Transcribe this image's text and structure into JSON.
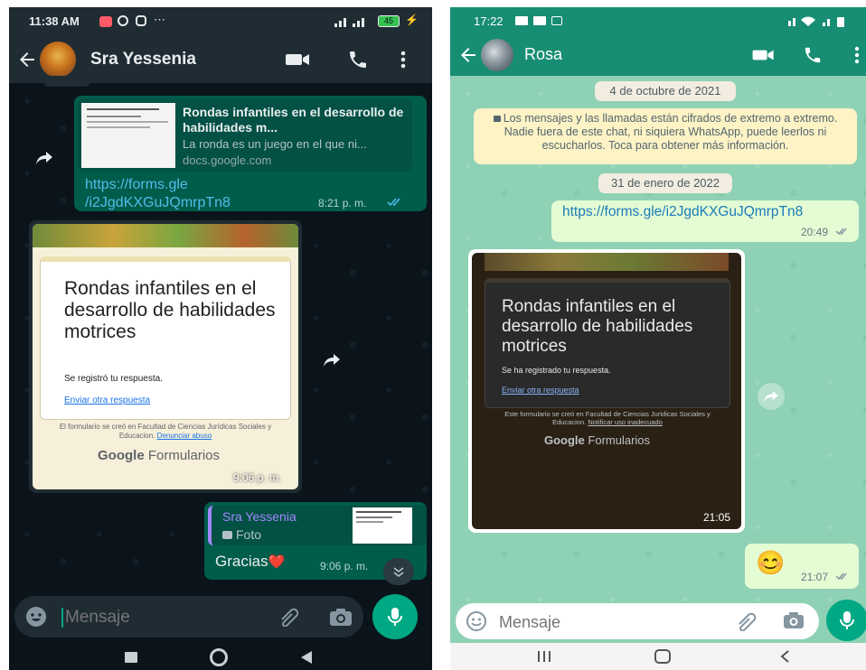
{
  "left_phone": {
    "status": {
      "time": "11:38 AM",
      "icons": "⋯",
      "battery": "45"
    },
    "header": {
      "contact_name": "Sra Yessenia"
    },
    "link_message": {
      "preview_title": "Rondas infantiles en el desarrollo de habilidades m...",
      "preview_desc": "La ronda es un juego en el que ni...",
      "preview_domain": "docs.google.com",
      "url_line1": "https://forms.gle",
      "url_line2": "/i2JgdKXGuJQmrpTn8",
      "time": "8:21 p. m."
    },
    "image_message": {
      "form_title": "Rondas infantiles en el desarrollo de habilidades motrices",
      "form_subtitle": "Se registró tu respuesta.",
      "form_link": "Enviar otra respuesta",
      "footer_text": "El formulario se creó en Facultad de Ciencias Jurídicas Sociales y Educacion.",
      "footer_link": "Denunciar abuso",
      "google_word": "Google",
      "forms_word": "Formularios",
      "time": "9:06 p. m."
    },
    "reply_message": {
      "quoted_name": "Sra Yessenia",
      "quoted_type": "Foto",
      "text": "Gracias",
      "emoji": "❤️",
      "time": "9:06 p. m."
    },
    "input": {
      "placeholder": "Mensaje"
    }
  },
  "right_phone": {
    "status": {
      "time": "17:22"
    },
    "header": {
      "contact_name": "Rosa"
    },
    "date_chip_1": "4 de octubre de 2021",
    "encryption_notice": "Los mensajes y las llamadas están cifrados de extremo a extremo. Nadie fuera de este chat, ni siquiera WhatsApp, puede leerlos ni escucharlos. Toca para obtener más información.",
    "date_chip_2": "31 de enero de 2022",
    "link_message": {
      "url": "https://forms.gle/i2JgdKXGuJQmrpTn8",
      "time": "20:49"
    },
    "image_message": {
      "form_title": "Rondas infantiles en el desarrollo de habilidades motrices",
      "form_subtitle": "Se ha registrado tu respuesta.",
      "form_link": "Enviar otra respuesta",
      "footer_text": "Este formulario se creó en Facultad de Ciencias Juridicas Sociales y Educacion.",
      "footer_link": "Notificar uso inadecuado",
      "google_word": "Google",
      "forms_word": "Formularios",
      "time": "21:05"
    },
    "emoji_message": {
      "emoji": "😊",
      "time": "21:07"
    },
    "input": {
      "placeholder": "Mensaje"
    }
  },
  "colors": {
    "dark_bg": "#0b141a",
    "dark_header": "#1f2c34",
    "dark_outgoing": "#005c4b",
    "light_header": "#178d73",
    "light_wallpaper": "#8fd1b5",
    "light_outgoing": "#e4fcd4",
    "accent_green": "#00a884",
    "link_blue": "#53bdeb",
    "read_ticks": "#53bdeb"
  },
  "icons": [
    "back-arrow-icon",
    "avatar",
    "video-call-icon",
    "phone-icon",
    "more-vert-icon",
    "forward-icon",
    "emoji-icon",
    "attach-icon",
    "camera-icon",
    "mic-icon",
    "lock-icon",
    "double-check-icon",
    "scroll-down-icon",
    "nav-square-icon",
    "nav-circle-icon",
    "nav-back-icon",
    "nav-recents-icon"
  ]
}
